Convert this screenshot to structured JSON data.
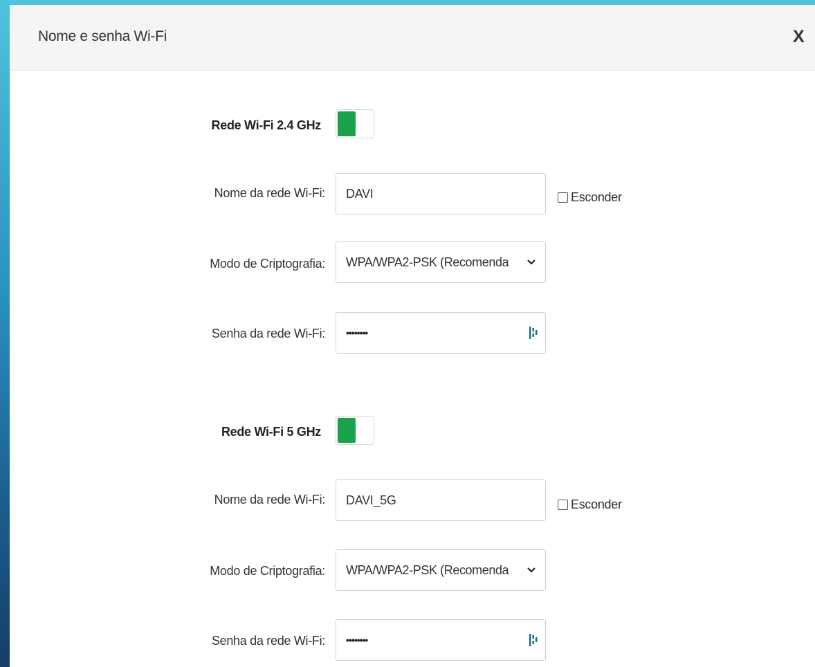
{
  "dialog": {
    "title": "Nome e senha Wi-Fi",
    "close_label": "X"
  },
  "networks": [
    {
      "band_label": "Rede Wi-Fi 2.4 GHz",
      "enabled": true,
      "name_label": "Nome da rede Wi-Fi:",
      "name_value": "DAVI",
      "hide_label": "Esconder",
      "hide_checked": false,
      "encryption_label": "Modo de Criptografia:",
      "encryption_value": "WPA/WPA2-PSK (Recomenda",
      "password_label": "Senha da rede Wi-Fi:",
      "password_masked": "••••••••"
    },
    {
      "band_label": "Rede Wi-Fi 5 GHz",
      "enabled": true,
      "name_label": "Nome da rede Wi-Fi:",
      "name_value": "DAVI_5G",
      "hide_label": "Esconder",
      "hide_checked": false,
      "encryption_label": "Modo de Criptografia:",
      "encryption_value": "WPA/WPA2-PSK (Recomenda",
      "password_label": "Senha da rede Wi-Fi:",
      "password_masked": "••••••••"
    }
  ],
  "colors": {
    "toggle_on": "#1aa34a",
    "header_bg": "#f5f5f5",
    "background_top": "#4fc3dc",
    "background_bottom": "#163e66"
  },
  "icons": {
    "close": "close-icon",
    "dropdown": "chevron-down-icon",
    "password_toggle": "eye-icon"
  }
}
